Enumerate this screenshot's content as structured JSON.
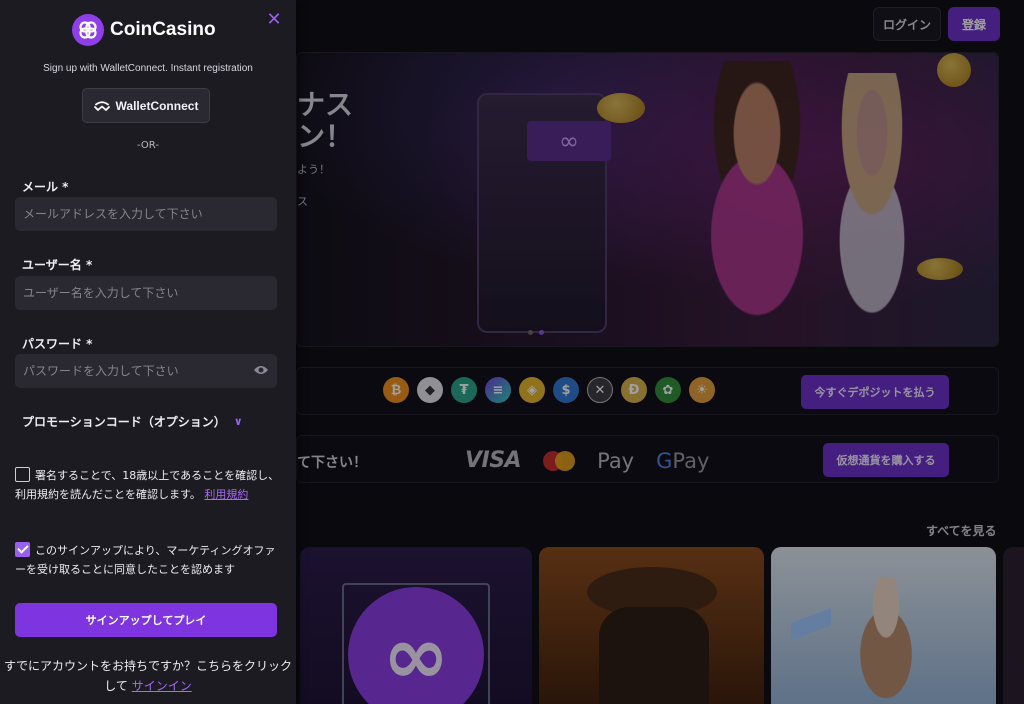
{
  "header": {
    "login_label": "ログイン",
    "register_label": "登録"
  },
  "hero": {
    "line1": "ナス",
    "line2": "ン！",
    "line3": "よう！",
    "line4": "ス",
    "carousel_dots": 2,
    "active_dot": 2
  },
  "crypto": {
    "icons": [
      "bitcoin-icon",
      "ethereum-icon",
      "tether-icon",
      "solana-icon",
      "bnb-icon",
      "usdc-icon",
      "xrp-icon",
      "dogecoin-icon",
      "rose-icon",
      "shiba-icon"
    ],
    "deposit_label": "今すぐデポジットを払う"
  },
  "payments": {
    "text": "て下さい！",
    "visa": "VISA",
    "applepay": "Pay",
    "gpay": "Pay",
    "buy_label": "仮想通貨を購入する"
  },
  "games": {
    "see_all": "すべてを見る"
  },
  "signup": {
    "brand": "CoinCasino",
    "subtitle": "Sign up with WalletConnect. Instant registration",
    "walletconnect_label": "WalletConnect",
    "or": "-OR-",
    "email_label": "メール *",
    "email_placeholder": "メールアドレスを入力して下さい",
    "username_label": "ユーザー名 *",
    "username_placeholder": "ユーザー名を入力して下さい",
    "password_label": "パスワード *",
    "password_placeholder": "パスワードを入力して下さい",
    "promo_label": "プロモーションコード（オプション）",
    "terms_text": "署名することで、18歳以上であることを確認し、利用規約を読んだことを確認します。",
    "terms_link": "利用規約",
    "terms_checked": false,
    "marketing_text": "このサインアップにより、マーケティングオファーを受け取ることに同意したことを認めます",
    "marketing_checked": true,
    "submit_label": "サインアップしてプレイ",
    "account_text": "すでにアカウントをお持ちですか？こちらをクリックして",
    "signin_link": "サインイン"
  },
  "colors": {
    "accent": "#7e35e0",
    "panel_bg": "#1c1b22",
    "input_bg": "#2a2931",
    "link": "#a56bf5"
  }
}
